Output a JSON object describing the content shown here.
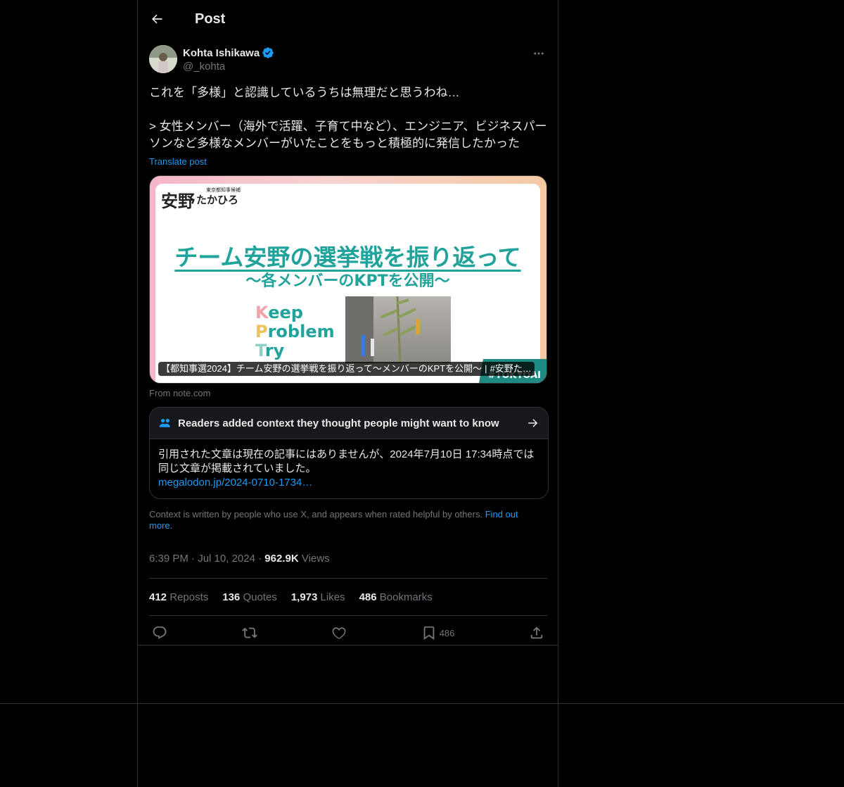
{
  "header": {
    "title": "Post"
  },
  "author": {
    "name": "Kohta Ishikawa",
    "handle": "@_kohta"
  },
  "post": {
    "text": "これを「多様」と認識しているうちは無理だと思うわね…\n\n> 女性メンバー（海外で活躍、子育て中など）、エンジニア、ビジネスパーソンなど多様なメンバーがいたことをもっと積極的に発信したかった",
    "translate_label": "Translate post"
  },
  "card": {
    "logo_small_top": "東京都知事候補",
    "logo_big": "安野",
    "logo_small": "たかひろ",
    "headline1": "チーム安野の選挙戦を振り返って",
    "headline2": "〜各メンバーのKPTを公開〜",
    "kpt": [
      {
        "letter": "K",
        "rest": "eep"
      },
      {
        "letter": "P",
        "rest": "roblem"
      },
      {
        "letter": "T",
        "rest": "ry"
      }
    ],
    "tokyo": "#TOKYOAI",
    "caption_title": "【都知事選2024】チーム安野の選挙戦を振り返って〜メンバーのKPTを公開〜",
    "caption_tag": "#安野た…",
    "from": "From note.com"
  },
  "note": {
    "title": "Readers added context they thought people might want to know",
    "body": "引用された文章は現在の記事にはありませんが、2024年7月10日 17:34時点では同じ文章が掲載されていました。",
    "link": "megalodon.jp/2024-0710-1734…"
  },
  "context": {
    "text": "Context is written by people who use X, and appears when rated helpful by others.",
    "find_out": "Find out more."
  },
  "meta": {
    "time": "6:39 PM",
    "date": "Jul 10, 2024",
    "views_count": "962.9K",
    "views_label": "Views",
    "sep": "·"
  },
  "stats": [
    {
      "count": "412",
      "label": "Reposts"
    },
    {
      "count": "136",
      "label": "Quotes"
    },
    {
      "count": "1,973",
      "label": "Likes"
    },
    {
      "count": "486",
      "label": "Bookmarks"
    }
  ],
  "actions": {
    "bookmark_count": "486"
  },
  "colors": {
    "accent": "#1d9bf0",
    "border": "#2f3336",
    "muted": "#71767b"
  }
}
